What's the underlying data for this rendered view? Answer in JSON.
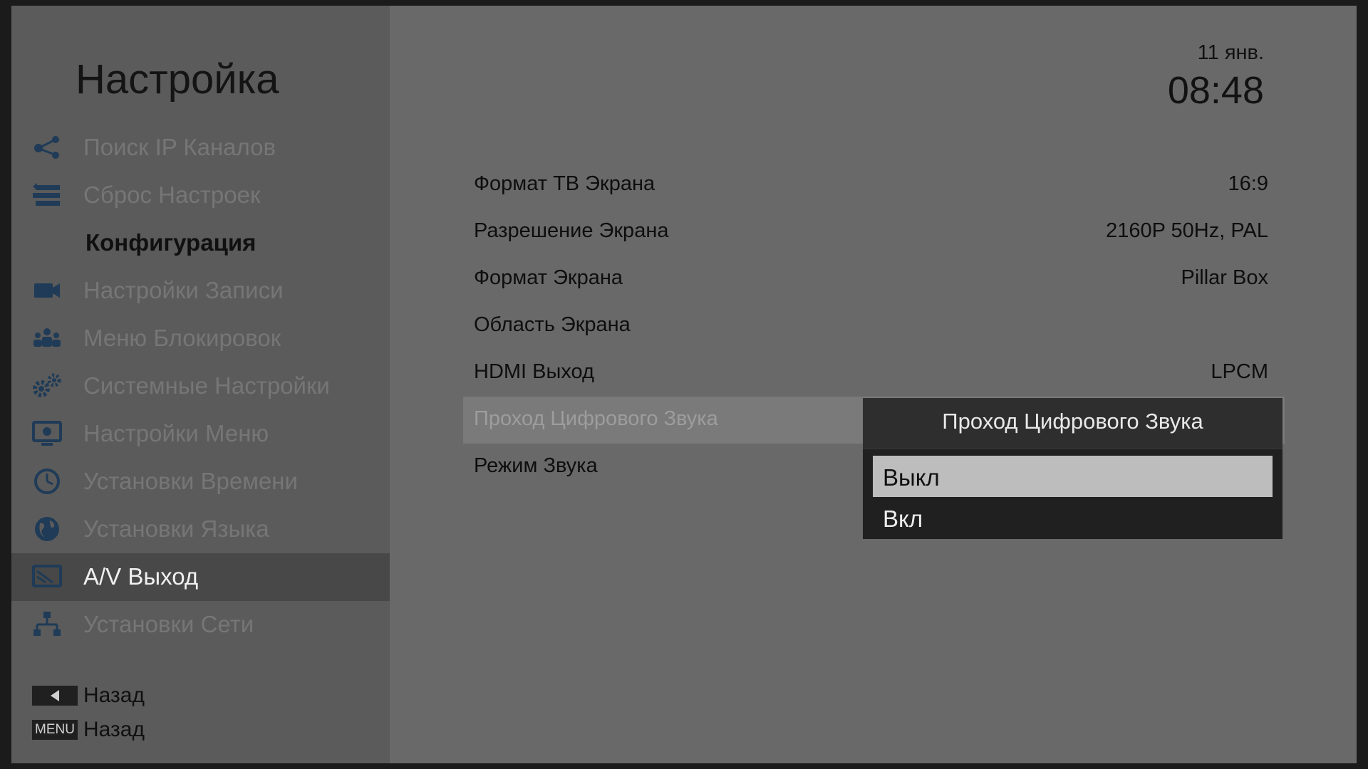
{
  "sidebar": {
    "title": "Настройка",
    "items": [
      {
        "label": "Поиск IP Каналов",
        "icon": "ip-search-icon"
      },
      {
        "label": "Сброс Настроек",
        "icon": "factory-reset-icon"
      },
      {
        "label": "Конфигурация",
        "icon": "",
        "type": "header"
      },
      {
        "label": "Настройки Записи",
        "icon": "video-camera-icon"
      },
      {
        "label": "Меню Блокировок",
        "icon": "parental-lock-icon"
      },
      {
        "label": "Системные Настройки",
        "icon": "gears-icon"
      },
      {
        "label": "Настройки Меню",
        "icon": "menu-monitor-icon"
      },
      {
        "label": "Установки Времени",
        "icon": "clock-icon"
      },
      {
        "label": "Установки Языка",
        "icon": "globe-icon"
      },
      {
        "label": "A/V Выход",
        "icon": "av-output-icon",
        "selected": true
      },
      {
        "label": "Установки Сети",
        "icon": "network-icon"
      }
    ]
  },
  "hints": [
    {
      "key": "◀",
      "key_icon": "left-arrow-icon",
      "label": "Назад"
    },
    {
      "key": "MENU",
      "label": "Назад"
    }
  ],
  "clock": {
    "date": "11 янв.",
    "time": "08:48"
  },
  "settings": [
    {
      "label": "Формат ТВ Экрана",
      "value": "16:9"
    },
    {
      "label": "Разрешение Экрана",
      "value": "2160P 50Hz, PAL"
    },
    {
      "label": "Формат Экрана",
      "value": "Pillar Box"
    },
    {
      "label": "Область Экрана",
      "value": ""
    },
    {
      "label": "HDMI Выход",
      "value": "LPCM"
    },
    {
      "label": "Проход Цифрового Звука",
      "value": "",
      "highlighted": true
    },
    {
      "label": "Режим Звука",
      "value": ""
    }
  ],
  "popup": {
    "title": "Проход Цифрового Звука",
    "options": [
      {
        "label": "Выкл",
        "selected": true
      },
      {
        "label": "Вкл"
      }
    ]
  },
  "colors": {
    "icon_blue": "#1f3b57",
    "background": "#696969",
    "sidebar": "#5b5b5b",
    "popup": "#202020"
  }
}
